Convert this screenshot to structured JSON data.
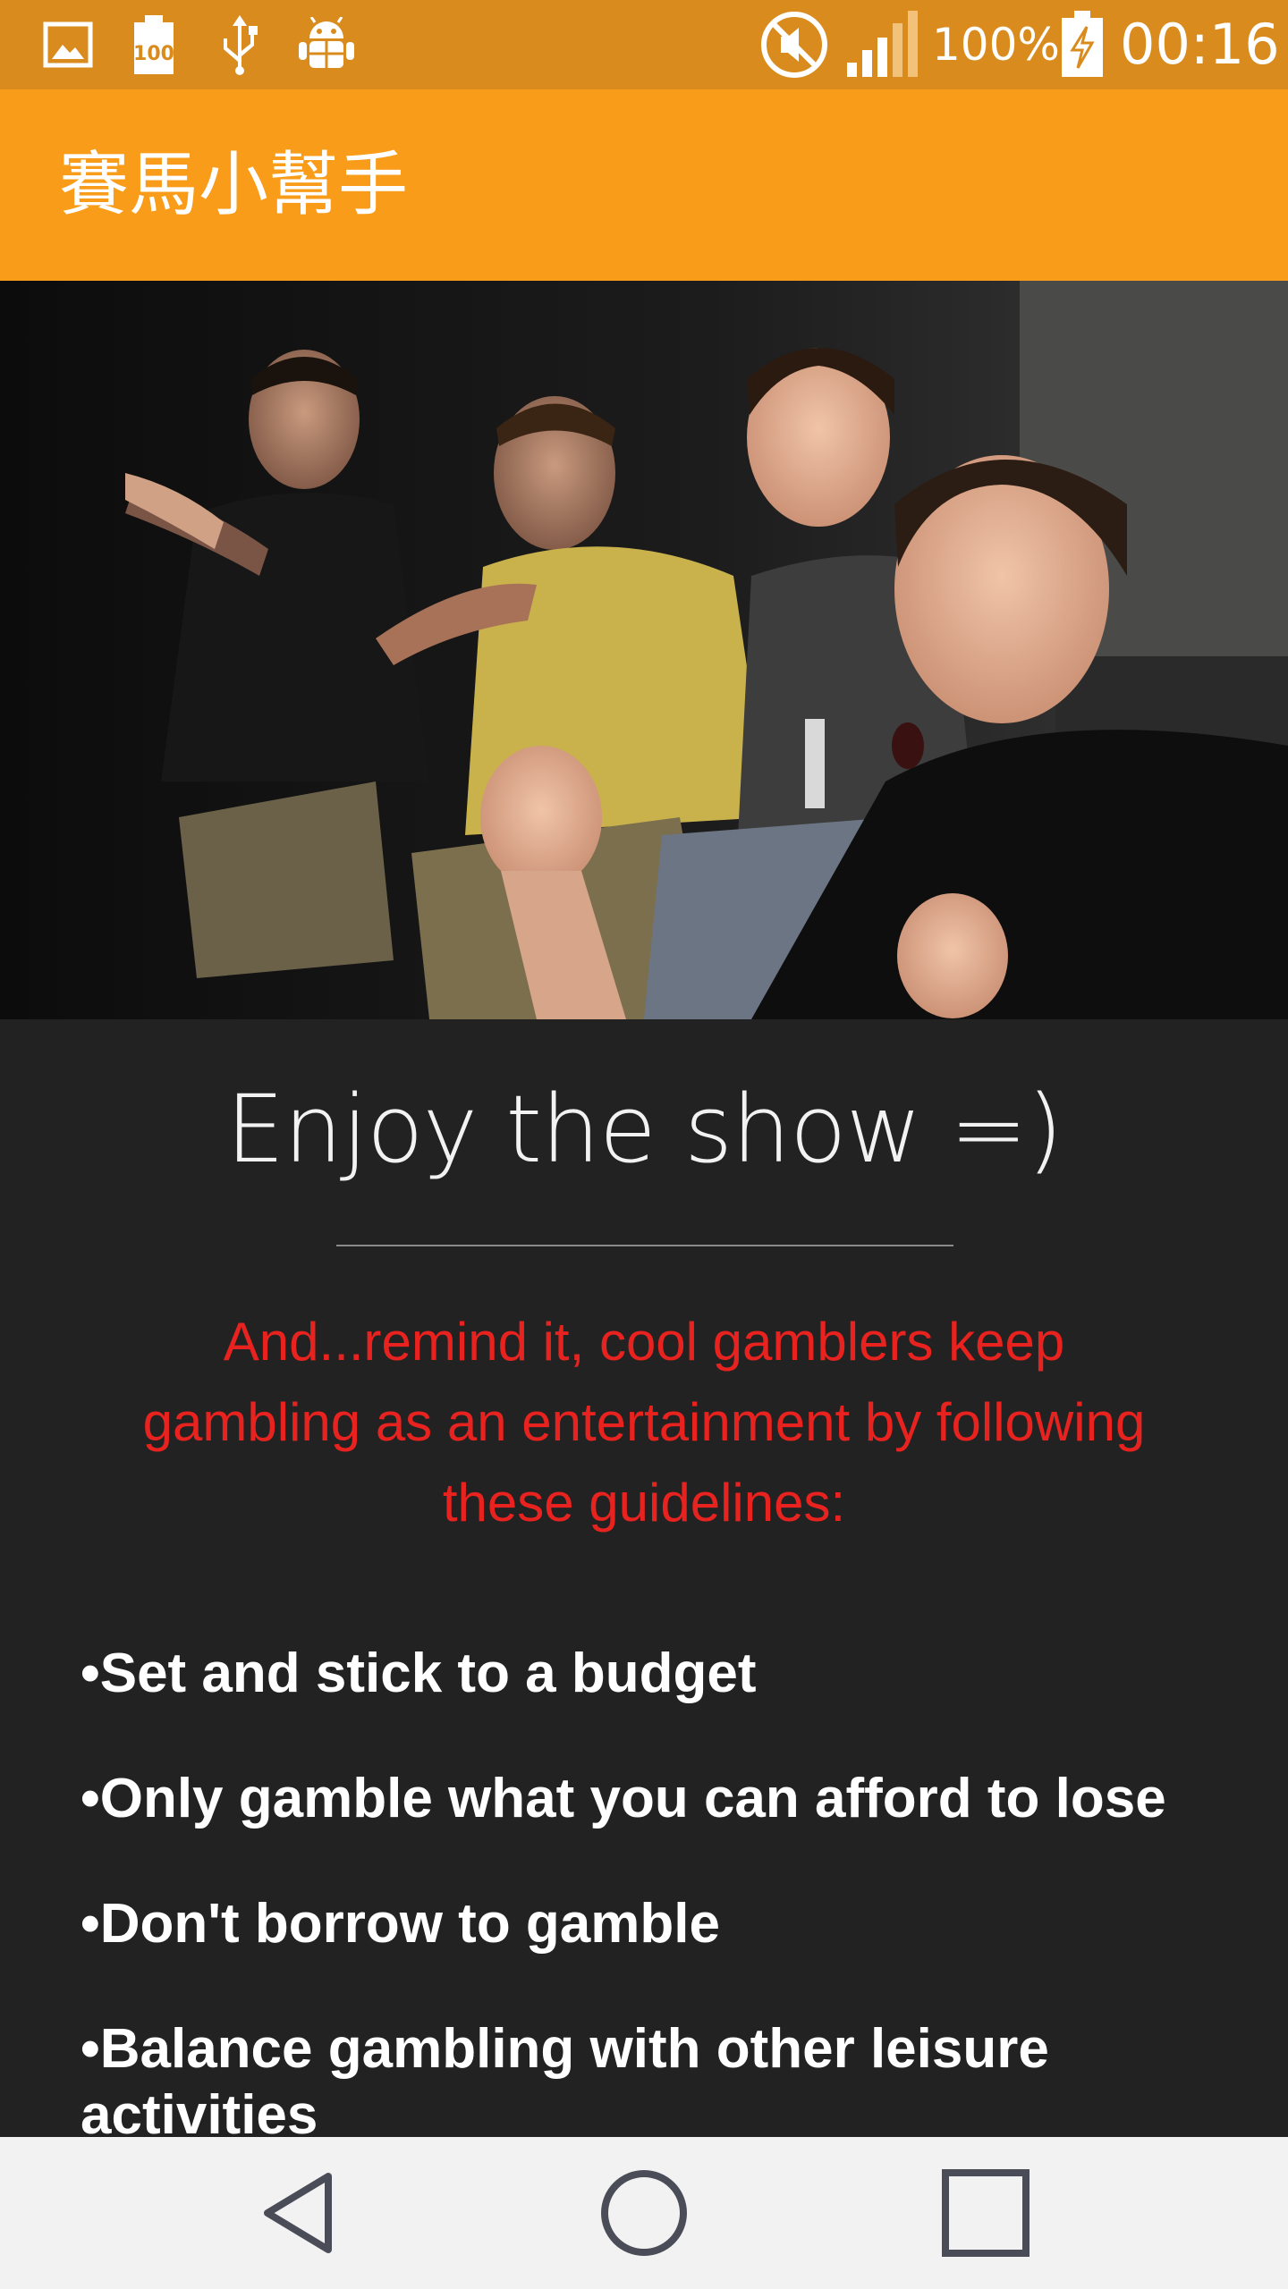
{
  "status_bar": {
    "battery_percent": "100%",
    "time": "00:16",
    "left_icons": [
      "gallery-icon",
      "battery-saver-100-icon",
      "usb-icon",
      "android-debug-icon"
    ],
    "right_icons": [
      "mute-icon",
      "signal-icon",
      "battery-charging-icon"
    ],
    "battery_level": 1.0
  },
  "app_bar": {
    "title": "賽馬小幫手"
  },
  "hero": {
    "image_description_icon": "excited-spectators-photo"
  },
  "content": {
    "headline": "Enjoy the show =)",
    "reminder": "And...remind it, cool gamblers keep gambling as an entertainment by following these guidelines:",
    "guidelines": [
      "Set and stick to a budget",
      "Only gamble what you can afford to lose",
      "Don't borrow to gamble",
      "Balance gambling with other leisure activities"
    ]
  },
  "nav_bar": {
    "icons": [
      "back-icon",
      "home-icon",
      "recents-icon"
    ]
  },
  "colors": {
    "status_bar": "#d98c1d",
    "app_bar": "#f89c19",
    "content_bg": "#222223",
    "reminder_text": "#e8231f",
    "nav_bar": "#f2f2f2"
  }
}
